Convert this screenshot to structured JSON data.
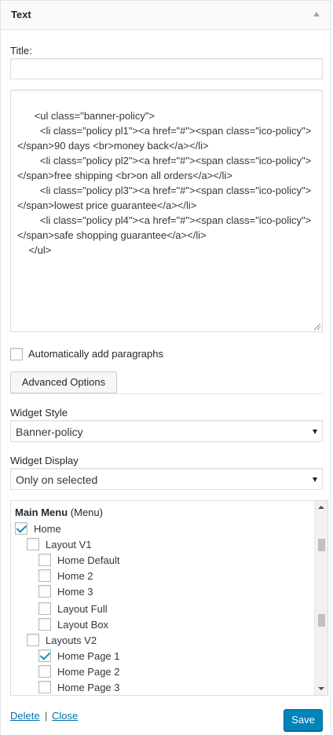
{
  "widget": {
    "title": "Text"
  },
  "form": {
    "title_label": "Title:",
    "title_value": "",
    "content": "    <ul class=\"banner-policy\">\n        <li class=\"policy pl1\"><a href=\"#\"><span class=\"ico-policy\"></span>90 days <br>money back</a></li>\n        <li class=\"policy pl2\"><a href=\"#\"><span class=\"ico-policy\"></span>free shipping <br>on all orders</a></li>\n        <li class=\"policy pl3\"><a href=\"#\"><span class=\"ico-policy\"></span>lowest price guarantee</a></li>\n        <li class=\"policy pl4\"><a href=\"#\"><span class=\"ico-policy\"></span>safe shopping guarantee</a></li>\n    </ul>",
    "auto_paragraphs_label": "Automatically add paragraphs",
    "auto_paragraphs_checked": false,
    "advanced_options_label": "Advanced Options"
  },
  "widget_style": {
    "label": "Widget Style",
    "selected": "Banner-policy"
  },
  "widget_display": {
    "label": "Widget Display",
    "selected": "Only on selected"
  },
  "menu_tree": {
    "heading": "Main Menu",
    "heading_suffix": "(Menu)",
    "items": [
      {
        "label": "Home",
        "checked": true
      },
      {
        "label": "Layout V1",
        "checked": false
      },
      {
        "label": "Home Default",
        "checked": false
      },
      {
        "label": "Home 2",
        "checked": false
      },
      {
        "label": "Home 3",
        "checked": false
      },
      {
        "label": "Layout Full",
        "checked": false
      },
      {
        "label": "Layout Box",
        "checked": false
      },
      {
        "label": "Layouts V2",
        "checked": false
      },
      {
        "label": "Home Page 1",
        "checked": true
      },
      {
        "label": "Home Page 2",
        "checked": false
      },
      {
        "label": "Home Page 3",
        "checked": false
      }
    ]
  },
  "footer": {
    "delete_label": "Delete",
    "separator": "|",
    "close_label": "Close",
    "save_label": "Save"
  },
  "colors": {
    "link": "#0073aa",
    "primary_button": "#0085ba",
    "checkmark": "#1e8cbe"
  }
}
